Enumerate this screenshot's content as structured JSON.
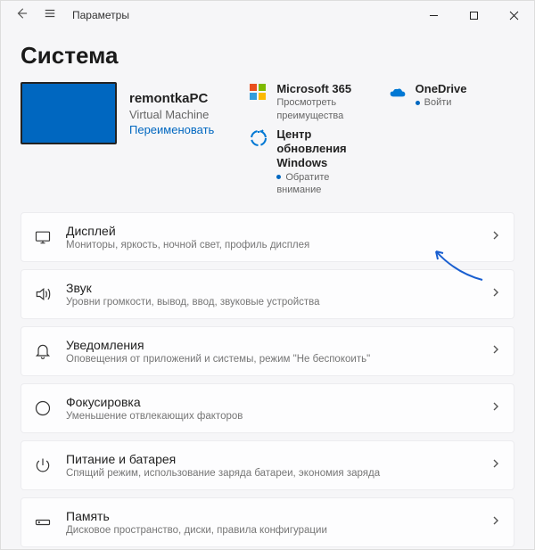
{
  "titlebar": {
    "title": "Параметры"
  },
  "page_title": "Система",
  "device": {
    "name": "remontkaPC",
    "type": "Virtual Machine",
    "rename": "Переименовать"
  },
  "tiles": {
    "ms365": {
      "title": "Microsoft 365",
      "sub": "Просмотреть преимущества"
    },
    "onedrive": {
      "title": "OneDrive",
      "sub": "Войти"
    },
    "wu": {
      "title": "Центр обновления Windows",
      "sub": "Обратите внимание"
    }
  },
  "rows": [
    {
      "icon": "display",
      "title": "Дисплей",
      "sub": "Мониторы, яркость, ночной свет, профиль дисплея"
    },
    {
      "icon": "sound",
      "title": "Звук",
      "sub": "Уровни громкости, вывод, ввод, звуковые устройства"
    },
    {
      "icon": "notifications",
      "title": "Уведомления",
      "sub": "Оповещения от приложений и системы, режим \"Не беспокоить\""
    },
    {
      "icon": "focus",
      "title": "Фокусировка",
      "sub": "Уменьшение отвлекающих факторов"
    },
    {
      "icon": "power",
      "title": "Питание и батарея",
      "sub": "Спящий режим, использование заряда батареи, экономия заряда"
    },
    {
      "icon": "storage",
      "title": "Память",
      "sub": "Дисковое пространство, диски, правила конфигурации"
    }
  ]
}
